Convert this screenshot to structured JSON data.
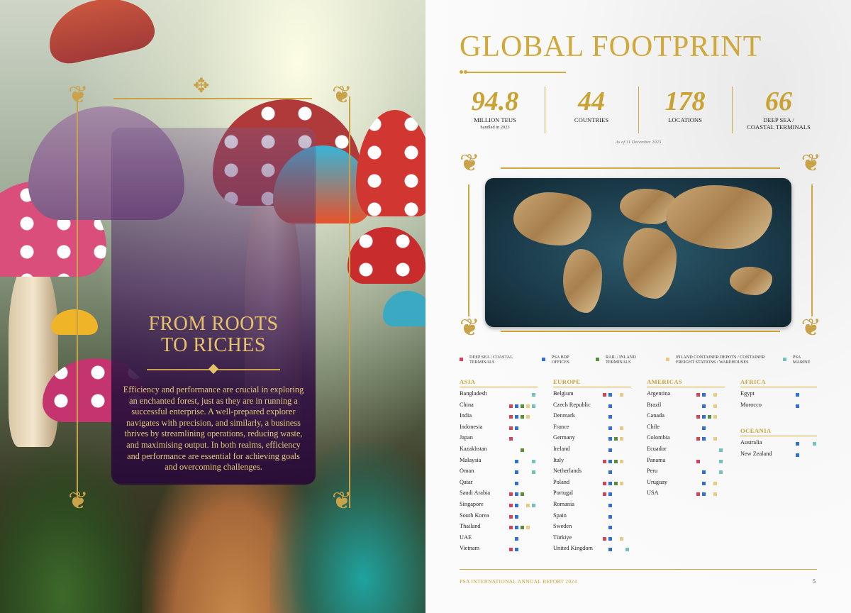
{
  "left": {
    "heading_line1": "FROM ROOTS",
    "heading_line2": "TO RICHES",
    "body": "Efficiency and performance are crucial in exploring an enchanted forest, just as they are in running a successful enterprise. A well-prepared explorer navigates with precision, and similarly, a business thrives by streamlining operations, reducing waste, and maximising output. In both realms, efficiency and performance are essential for achieving goals and overcoming challenges."
  },
  "right": {
    "title": "GLOBAL FOOTPRINT",
    "stats": [
      {
        "value": "94.8",
        "label": "MILLION TEUS",
        "sub": "handled in 2023"
      },
      {
        "value": "44",
        "label": "COUNTRIES",
        "sub": ""
      },
      {
        "value": "178",
        "label": "LOCATIONS",
        "sub": ""
      },
      {
        "value": "66",
        "label": "DEEP SEA /",
        "label2": "COASTAL TERMINALS",
        "sub": ""
      }
    ],
    "as_of": "As of 31 December 2023",
    "colors": {
      "deep_sea": "#d6425a",
      "bdp": "#2f6fd6",
      "rail": "#5a8f3a",
      "inland": "#eacb86",
      "marine": "#74c2bd",
      "gold": "#c9a232"
    },
    "legend": [
      {
        "line1": "DEEP SEA / COASTAL",
        "line2": "TERMINALS",
        "color": "#d6425a"
      },
      {
        "line1": "PSA BDP",
        "line2": "OFFICES",
        "color": "#2f6fd6"
      },
      {
        "line1": "RAIL / INLAND",
        "line2": "TERMINALS",
        "color": "#5a8f3a"
      },
      {
        "line1": "INLAND CONTAINER DEPOTS / CONTAINER",
        "line2": "FREIGHT STATIONS / WAREHOUSES",
        "color": "#eacb86"
      },
      {
        "line1": "PSA",
        "line2": "MARINE",
        "color": "#74c2bd"
      }
    ],
    "regions": {
      "asia": {
        "name": "ASIA",
        "countries": [
          {
            "name": "Bangladesh",
            "types": [
              "marine"
            ]
          },
          {
            "name": "China",
            "types": [
              "deep_sea",
              "bdp",
              "rail",
              "inland",
              "marine"
            ]
          },
          {
            "name": "India",
            "types": [
              "deep_sea",
              "bdp",
              "rail",
              "inland"
            ]
          },
          {
            "name": "Indonesia",
            "types": [
              "deep_sea",
              "bdp"
            ]
          },
          {
            "name": "Japan",
            "types": [
              "deep_sea"
            ]
          },
          {
            "name": "Kazakhstan",
            "types": [
              "rail"
            ]
          },
          {
            "name": "Malaysia",
            "types": [
              "bdp",
              "marine"
            ]
          },
          {
            "name": "Oman",
            "types": [
              "bdp",
              "marine"
            ]
          },
          {
            "name": "Qatar",
            "types": [
              "bdp"
            ]
          },
          {
            "name": "Saudi Arabia",
            "types": [
              "deep_sea",
              "bdp",
              "rail"
            ]
          },
          {
            "name": "Singapore",
            "types": [
              "deep_sea",
              "bdp",
              "inland",
              "marine"
            ]
          },
          {
            "name": "South Korea",
            "types": [
              "deep_sea",
              "bdp"
            ]
          },
          {
            "name": "Thailand",
            "types": [
              "deep_sea",
              "bdp",
              "rail",
              "inland"
            ]
          },
          {
            "name": "UAE",
            "types": [
              "bdp"
            ]
          },
          {
            "name": "Vietnam",
            "types": [
              "deep_sea",
              "bdp"
            ]
          }
        ]
      },
      "europe": {
        "name": "EUROPE",
        "countries": [
          {
            "name": "Belgium",
            "types": [
              "deep_sea",
              "bdp",
              "inland"
            ]
          },
          {
            "name": "Czech Republic",
            "types": [
              "bdp"
            ]
          },
          {
            "name": "Denmark",
            "types": [
              "bdp"
            ]
          },
          {
            "name": "France",
            "types": [
              "bdp",
              "inland"
            ]
          },
          {
            "name": "Germany",
            "types": [
              "bdp",
              "rail",
              "inland"
            ]
          },
          {
            "name": "Ireland",
            "types": [
              "bdp"
            ]
          },
          {
            "name": "Italy",
            "types": [
              "deep_sea",
              "bdp",
              "rail",
              "inland"
            ]
          },
          {
            "name": "Netherlands",
            "types": [
              "bdp"
            ]
          },
          {
            "name": "Poland",
            "types": [
              "deep_sea",
              "bdp",
              "rail",
              "inland"
            ]
          },
          {
            "name": "Portugal",
            "types": [
              "deep_sea",
              "bdp"
            ]
          },
          {
            "name": "Romania",
            "types": [
              "bdp"
            ]
          },
          {
            "name": "Spain",
            "types": [
              "bdp"
            ]
          },
          {
            "name": "Sweden",
            "types": [
              "bdp"
            ]
          },
          {
            "name": "Türkiye",
            "types": [
              "deep_sea",
              "bdp",
              "inland"
            ]
          },
          {
            "name": "United Kingdom",
            "types": [
              "bdp",
              "marine"
            ]
          }
        ]
      },
      "americas": {
        "name": "AMERICAS",
        "countries": [
          {
            "name": "Argentina",
            "types": [
              "deep_sea",
              "bdp",
              "inland"
            ]
          },
          {
            "name": "Brazil",
            "types": [
              "bdp",
              "inland"
            ]
          },
          {
            "name": "Canada",
            "types": [
              "deep_sea",
              "bdp",
              "rail",
              "inland"
            ]
          },
          {
            "name": "Chile",
            "types": [
              "bdp"
            ]
          },
          {
            "name": "Colombia",
            "types": [
              "deep_sea",
              "bdp",
              "inland"
            ]
          },
          {
            "name": "Ecuador",
            "types": [
              "marine"
            ]
          },
          {
            "name": "Panama",
            "types": [
              "deep_sea",
              "marine"
            ]
          },
          {
            "name": "Peru",
            "types": [
              "bdp",
              "marine"
            ]
          },
          {
            "name": "Uruguay",
            "types": [
              "bdp",
              "inland"
            ]
          },
          {
            "name": "USA",
            "types": [
              "deep_sea",
              "bdp",
              "inland"
            ]
          }
        ]
      },
      "africa": {
        "name": "AFRICA",
        "countries": [
          {
            "name": "Egypt",
            "types": [
              "bdp"
            ]
          },
          {
            "name": "Morocco",
            "types": [
              "bdp"
            ]
          }
        ]
      },
      "oceania": {
        "name": "OCEANIA",
        "countries": [
          {
            "name": "Australia",
            "types": [
              "bdp",
              "marine"
            ]
          },
          {
            "name": "New Zealand",
            "types": [
              "bdp"
            ]
          }
        ]
      }
    },
    "footer": "PSA INTERNATIONAL ANNUAL REPORT 2024",
    "page_number": "5"
  }
}
